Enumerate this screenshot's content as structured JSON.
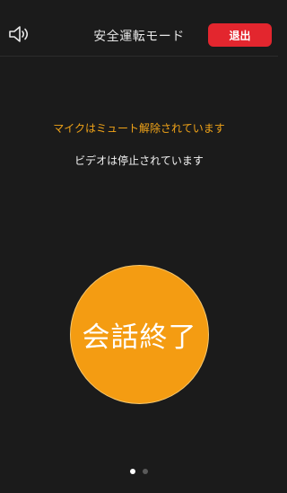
{
  "header": {
    "speaker_icon": "speaker-icon",
    "title": "安全運転モード",
    "leave_label": "退出"
  },
  "status": {
    "mic_text": "マイクはミュート解除されています",
    "video_text": "ビデオは停止されています"
  },
  "end_call": {
    "label": "会話終了"
  },
  "pager": {
    "count": 2,
    "active_index": 0
  },
  "colors": {
    "background": "#1b1b1b",
    "mic_status": "#f0a318",
    "leave_button": "#e3262e",
    "end_call_button": "#f49c12"
  }
}
